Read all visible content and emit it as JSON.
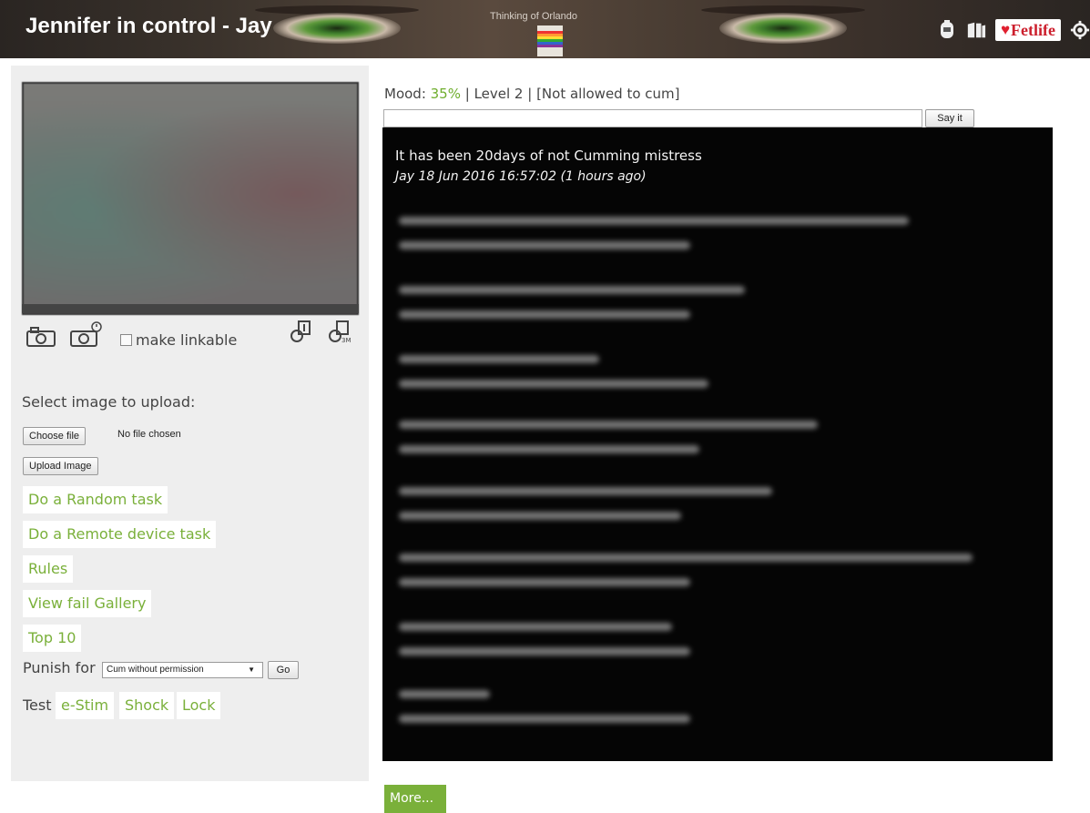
{
  "header": {
    "title": "Jennifer in control - Jay",
    "thinking_text": "Thinking of Orlando",
    "icons": [
      "piggy-bank-icon",
      "books-icon",
      "fetlife-logo",
      "gear-icon"
    ],
    "fetlife_label": "Fetlife"
  },
  "sidebar": {
    "make_linkable_label": "make linkable",
    "select_image_label": "Select image to upload:",
    "choose_file_label": "Choose file",
    "no_file_label": "No file chosen",
    "upload_label": "Upload Image",
    "links": {
      "random_task": "Do a Random task",
      "remote_task": "Do a Remote device task",
      "rules": "Rules",
      "fail_gallery": "View fail Gallery",
      "top10": "Top 10"
    },
    "punish_label": "Punish for",
    "punish_selected": "Cum without permission",
    "go_label": "Go",
    "test_label": "Test",
    "test_links": {
      "estim": "e-Stim",
      "shock": "Shock",
      "lock": "Lock"
    }
  },
  "main": {
    "mood_prefix": "Mood: ",
    "mood_value": "35%",
    "mood_suffix": " | Level 2 | [Not allowed to cum]",
    "say_label": "Say it",
    "first_message": "It has been 20days of not Cumming mistress",
    "first_meta": "Jay 18 Jun 2016 16:57:02 (1 hours ago)",
    "more_label": "More..."
  },
  "colors": {
    "accent_green": "#7ab03a",
    "mood_green": "#6fae2e",
    "chat_bg": "#050505",
    "sidebar_bg": "#eeeeee",
    "fetlife_red": "#cc1f2d"
  }
}
